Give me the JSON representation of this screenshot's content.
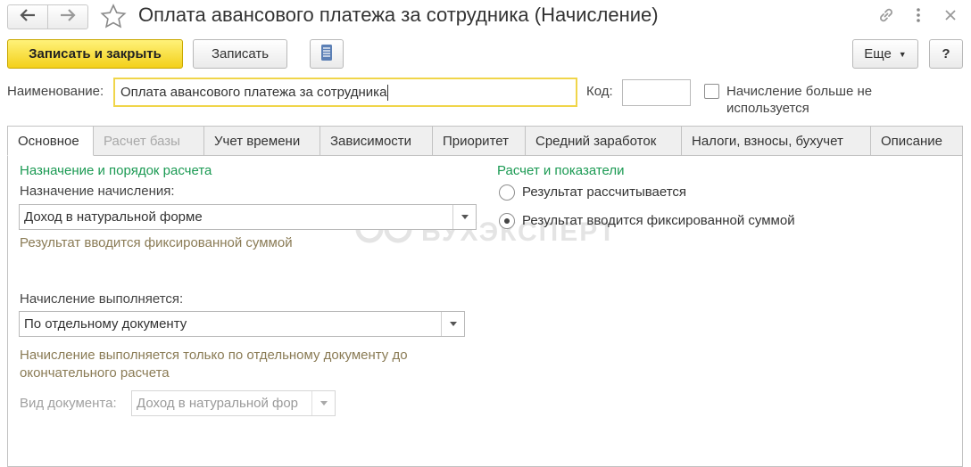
{
  "window": {
    "title": "Оплата авансового платежа за сотрудника (Начисление)"
  },
  "icons": {
    "back": "arrow-left-icon",
    "forward": "arrow-right-icon",
    "favorite": "star-icon",
    "link": "link-icon",
    "menu": "more-vertical-icon",
    "close": "close-icon",
    "list": "list-icon"
  },
  "toolbar": {
    "save_close_label": "Записать и закрыть",
    "save_label": "Записать",
    "more_label": "Еще",
    "help_label": "?"
  },
  "header": {
    "name_label": "Наименование:",
    "name_value": "Оплата авансового платежа за сотрудника",
    "code_label": "Код:",
    "code_value": "",
    "unused_label_line1": "Начисление больше не",
    "unused_label_line2": "используется"
  },
  "tabs": [
    {
      "label": "Основное"
    },
    {
      "label": "Расчет базы"
    },
    {
      "label": "Учет времени"
    },
    {
      "label": "Зависимости"
    },
    {
      "label": "Приоритет"
    },
    {
      "label": "Средний заработок"
    },
    {
      "label": "Налоги, взносы, бухучет"
    },
    {
      "label": "Описание"
    }
  ],
  "main": {
    "purpose_section_title": "Назначение и порядок расчета",
    "purpose_label": "Назначение начисления:",
    "purpose_value": "Доход в натуральной форме",
    "purpose_hint": "Результат вводится фиксированной суммой",
    "execution_label": "Начисление выполняется:",
    "execution_value": "По отдельному документу",
    "execution_hint_line1": "Начисление выполняется только по отдельному документу до",
    "execution_hint_line2": "окончательного расчета",
    "doc_type_label": "Вид документа:",
    "doc_type_value": "Доход в натуральной фор",
    "calc_section_title": "Расчет и показатели",
    "radio_calculated": "Результат рассчитывается",
    "radio_fixed": "Результат вводится фиксированной суммой"
  },
  "watermark": {
    "text": "БУХЭКСПЕРТ"
  },
  "colors": {
    "accent_green": "#1b9a53",
    "primary_button": "#f3d01a",
    "hint_text": "#8a7b55",
    "focus_border": "#f0d54a"
  }
}
